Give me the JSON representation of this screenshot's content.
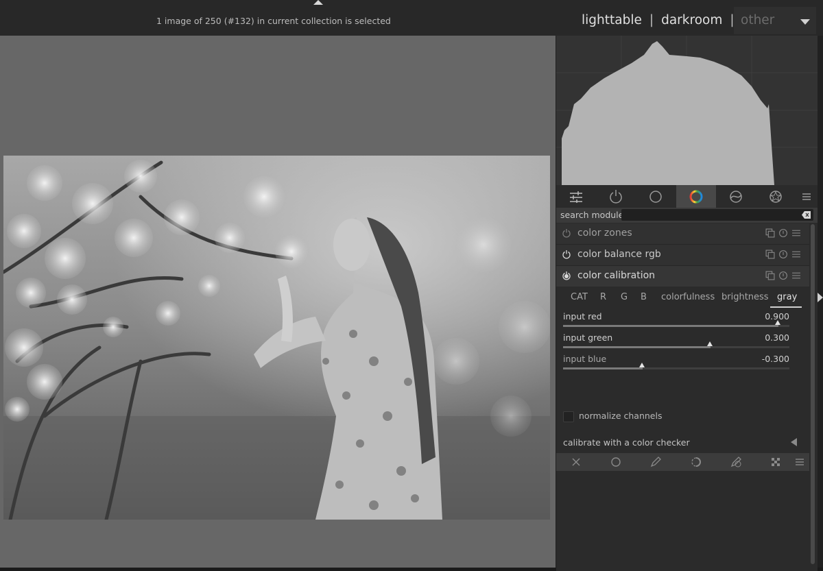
{
  "header": {
    "status": "1 image of 250 (#132) in current collection is selected",
    "views": [
      "lighttable",
      "darkroom"
    ],
    "separator": "|",
    "other": "other"
  },
  "icons": {
    "top_arrow": "triangle-up-icon",
    "tabs": [
      "sliders-icon",
      "power-icon",
      "circle-icon",
      "color-wheel-icon",
      "correct-icon",
      "effect-icon",
      "menu-icon"
    ],
    "module_actions": [
      "multi-instance-icon",
      "reset-icon",
      "presets-icon"
    ],
    "bottom_tools": [
      "close-icon",
      "circle-icon",
      "pencil-icon",
      "brush-icon",
      "gradient-icon",
      "checker-icon",
      "menu-icon"
    ]
  },
  "search": {
    "label": "search module",
    "value": ""
  },
  "modules": [
    {
      "name": "color zones",
      "enabled": false
    },
    {
      "name": "color balance rgb",
      "enabled": true
    },
    {
      "name": "color calibration",
      "enabled": true,
      "expanded": true
    }
  ],
  "calibration": {
    "tabs": [
      "CAT",
      "R",
      "G",
      "B",
      "colorfulness",
      "brightness",
      "gray"
    ],
    "active_tab": "gray",
    "sliders": [
      {
        "label": "input red",
        "value": "0.900",
        "num": 0.9
      },
      {
        "label": "input green",
        "value": "0.300",
        "num": 0.3
      },
      {
        "label": "input blue",
        "value": "-0.300",
        "num": -0.3
      }
    ],
    "checkbox": {
      "label": "normalize channels",
      "checked": false
    },
    "checker": "calibrate with a color checker"
  },
  "colors": {
    "active_tab_bg": "#484848",
    "panel_bg": "#2b2b2b",
    "center_bg": "#676767",
    "histogram_fill": "#b3b3b3"
  }
}
